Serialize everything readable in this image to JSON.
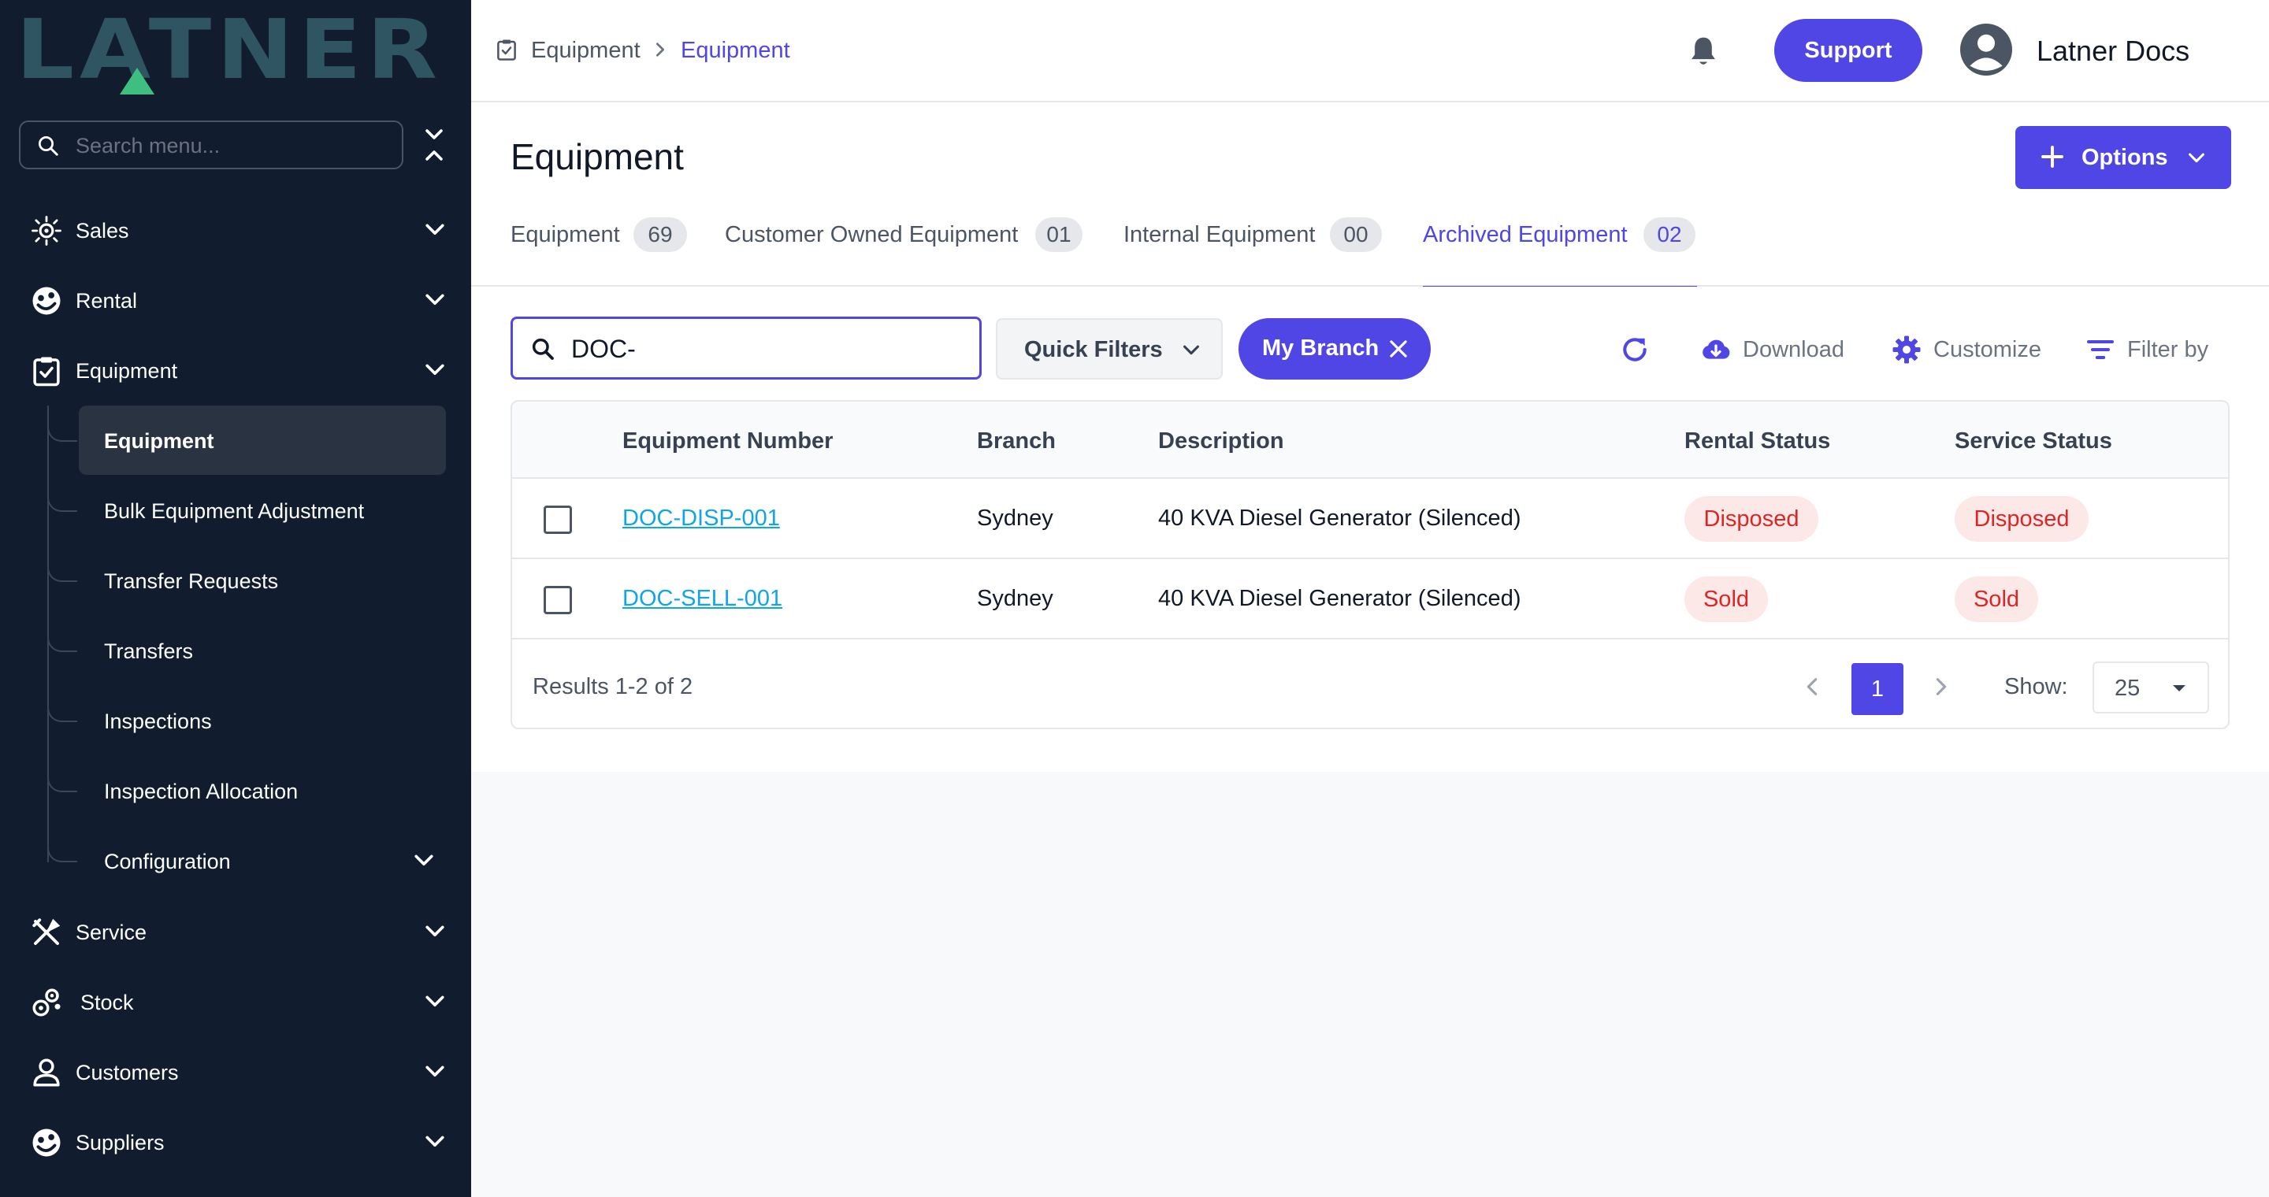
{
  "brand": {
    "name": "LATNER"
  },
  "sidebar": {
    "search_placeholder": "Search menu...",
    "items": [
      {
        "label": "Sales",
        "icon": "sales-icon"
      },
      {
        "label": "Rental",
        "icon": "rental-icon"
      },
      {
        "label": "Equipment",
        "icon": "equipment-clipboard-icon"
      },
      {
        "label": "Service",
        "icon": "service-tools-icon"
      },
      {
        "label": "Stock",
        "icon": "stock-icon"
      },
      {
        "label": "Customers",
        "icon": "user-icon"
      },
      {
        "label": "Suppliers",
        "icon": "suppliers-icon"
      }
    ],
    "equipment_sub": [
      {
        "label": "Equipment",
        "active": true
      },
      {
        "label": "Bulk Equipment Adjustment"
      },
      {
        "label": "Transfer Requests"
      },
      {
        "label": "Transfers"
      },
      {
        "label": "Inspections"
      },
      {
        "label": "Inspection Allocation"
      },
      {
        "label": "Configuration"
      }
    ]
  },
  "header": {
    "breadcrumb": [
      "Equipment",
      "Equipment"
    ],
    "support_label": "Support",
    "user_name": "Latner Docs"
  },
  "page": {
    "title": "Equipment",
    "options_label": "Options",
    "tabs": [
      {
        "label": "Equipment",
        "count": "69"
      },
      {
        "label": "Customer Owned Equipment",
        "count": "01"
      },
      {
        "label": "Internal Equipment",
        "count": "00"
      },
      {
        "label": "Archived Equipment",
        "count": "02",
        "active": true
      }
    ]
  },
  "toolbar": {
    "search_value": "DOC-",
    "quick_filters_label": "Quick Filters",
    "branch_chip_label": "My Branch",
    "download_label": "Download",
    "customize_label": "Customize",
    "filter_label": "Filter by"
  },
  "table": {
    "columns": [
      "Equipment Number",
      "Branch",
      "Description",
      "Rental Status",
      "Service Status"
    ],
    "rows": [
      {
        "number": "DOC-DISP-001",
        "branch": "Sydney",
        "description": "40 KVA Diesel Generator (Silenced)",
        "rental_status": "Disposed",
        "service_status": "Disposed"
      },
      {
        "number": "DOC-SELL-001",
        "branch": "Sydney",
        "description": "40 KVA Diesel Generator (Silenced)",
        "rental_status": "Sold",
        "service_status": "Sold"
      }
    ],
    "results_text": "Results 1-2 of 2",
    "current_page": "1",
    "show_label": "Show:",
    "page_size": "25"
  },
  "colors": {
    "sidebar_bg": "#111c2e",
    "accent": "#4f46e5",
    "badge_bg": "#fde8e8",
    "badge_text": "#dc2626",
    "link": "#0ea5e9"
  }
}
